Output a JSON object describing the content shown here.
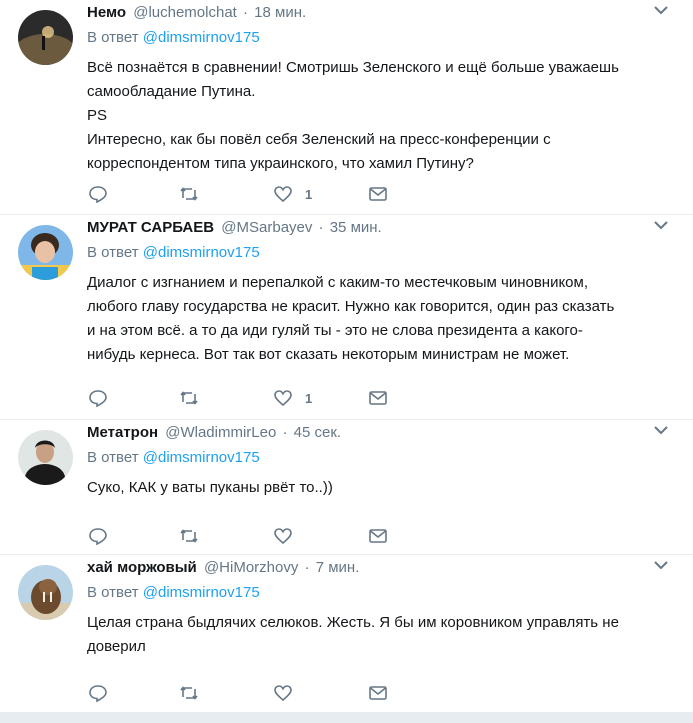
{
  "tweets": [
    {
      "name": "Немо",
      "handle": "@luchemolchat",
      "dot": "·",
      "time": "18 мин.",
      "reply_prefix": "В ответ",
      "reply_mention": "@dimsmirnov175",
      "lines": [
        "Всё познаётся в сравнении! Смотришь Зеленского и ещё больше уважаешь",
        "самообладание Путина.",
        "PS",
        "Интересно, как бы повёл себя Зеленский на пресс-конференции с",
        "корреспондентом типа украинского, что хамил Путину?"
      ],
      "like_count": "1",
      "avatar_colors": [
        "#2b2b2b",
        "#6b5a3e",
        "#e8c98a"
      ]
    },
    {
      "name": "МУРАТ САРБАЕВ",
      "handle": "@MSarbayev",
      "dot": "·",
      "time": "35 мин.",
      "reply_prefix": "В ответ",
      "reply_mention": "@dimsmirnov175",
      "lines": [
        "Диалог с изгнанием и перепалкой с каким-то местечковым чиновником,",
        "любого главу государства не красит. Нужно как говорится, один раз сказать",
        "и на этом всё. а то да иди гуляй ты - это не слова президента а какого-",
        "нибудь кернеса. Вот так вот сказать некоторым министрам не может."
      ],
      "like_count": "1",
      "avatar_colors": [
        "#7fb8e8",
        "#3a2a1e",
        "#e9c2a6"
      ]
    },
    {
      "name": "Метатрон",
      "handle": "@WladimmirLeo",
      "dot": "·",
      "time": "45 сек.",
      "reply_prefix": "В ответ",
      "reply_mention": "@dimsmirnov175",
      "lines": [
        "Суко, КАК у ваты пуканы рвёт то..))"
      ],
      "like_count": "",
      "avatar_colors": [
        "#dfe6e3",
        "#1a1a1a",
        "#c8a083"
      ]
    },
    {
      "name": "хай моржовый",
      "handle": "@HiMorzhovy",
      "dot": "·",
      "time": "7 мин.",
      "reply_prefix": "В ответ",
      "reply_mention": "@dimsmirnov175",
      "lines": [
        "Целая страна быдлячих селюков. Жесть. Я бы им коровником управлять не",
        "доверил"
      ],
      "like_count": "",
      "avatar_colors": [
        "#b9d4e6",
        "#6b4a2e",
        "#8a6240"
      ]
    }
  ],
  "icons": {
    "reply": "reply-icon",
    "retweet": "retweet-icon",
    "like": "heart-icon",
    "dm": "envelope-icon",
    "more": "chevron-down-icon"
  },
  "colors": {
    "link": "#1da1f2",
    "secondary": "#657786",
    "border": "#e6ecf0"
  }
}
